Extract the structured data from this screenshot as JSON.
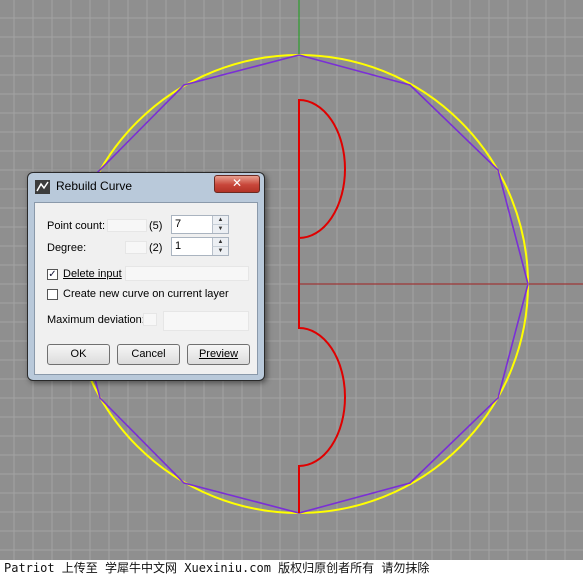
{
  "dialog": {
    "title": "Rebuild Curve",
    "close_glyph": "✕",
    "point_count": {
      "label": "Point count:",
      "current": "(5)",
      "value": "7"
    },
    "degree": {
      "label": "Degree:",
      "current": "(2)",
      "value": "1"
    },
    "delete_input": {
      "label": "Delete input",
      "checked": true,
      "mark": "✓"
    },
    "create_new_curve": {
      "label": "Create new curve on current layer",
      "checked": false
    },
    "max_deviation": {
      "label": "Maximum deviation:",
      "value": ""
    },
    "buttons": {
      "ok": "OK",
      "cancel": "Cancel",
      "preview": "Preview"
    }
  },
  "viewport": {
    "background": "#8f8f8f",
    "grid_color": "#a3a3a3",
    "x_axis_color": "#a02020",
    "y_axis_color": "#1aa01a",
    "original_curve_color": "#ffff00",
    "profile_curve_color": "#e00000",
    "rebuilt_curve_color": "#7a2fd6",
    "spin_up_icon": "▲",
    "spin_down_icon": "▼"
  },
  "watermark": "Patriot 上传至 学犀牛中文网 Xuexiniu.com 版权归原创者所有 请勿抹除"
}
